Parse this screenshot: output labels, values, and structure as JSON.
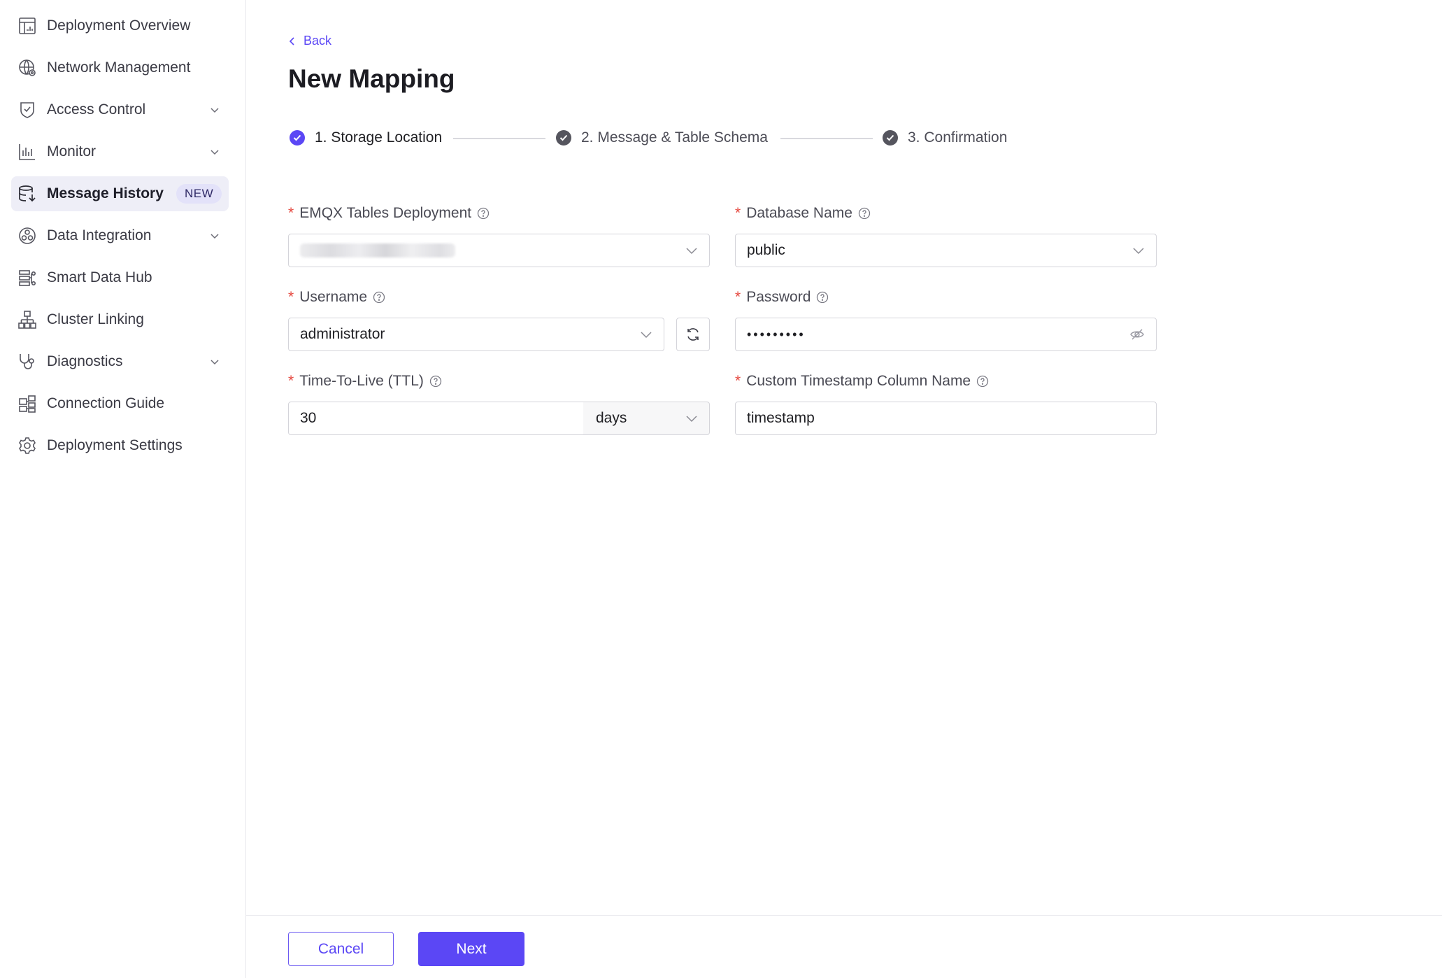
{
  "sidebar": {
    "items": [
      {
        "label": "Deployment Overview",
        "icon": "dashboard-icon",
        "expandable": false
      },
      {
        "label": "Network Management",
        "icon": "globe-gear-icon",
        "expandable": false
      },
      {
        "label": "Access Control",
        "icon": "shield-check-icon",
        "expandable": true
      },
      {
        "label": "Monitor",
        "icon": "bar-chart-icon",
        "expandable": true
      },
      {
        "label": "Message History",
        "icon": "database-download-icon",
        "expandable": false,
        "active": true,
        "badge": "NEW"
      },
      {
        "label": "Data Integration",
        "icon": "integration-icon",
        "expandable": true
      },
      {
        "label": "Smart Data Hub",
        "icon": "data-hub-icon",
        "expandable": false
      },
      {
        "label": "Cluster Linking",
        "icon": "cluster-tree-icon",
        "expandable": false
      },
      {
        "label": "Diagnostics",
        "icon": "stethoscope-icon",
        "expandable": true
      },
      {
        "label": "Connection Guide",
        "icon": "connection-guide-icon",
        "expandable": false
      },
      {
        "label": "Deployment Settings",
        "icon": "gear-icon",
        "expandable": false
      }
    ]
  },
  "main": {
    "back_label": "Back",
    "title": "New Mapping",
    "steps": [
      {
        "label": "1. Storage Location",
        "status": "current"
      },
      {
        "label": "2. Message & Table Schema",
        "status": "pending"
      },
      {
        "label": "3. Confirmation",
        "status": "pending"
      }
    ],
    "form": {
      "deployment": {
        "label": "EMQX Tables Deployment",
        "required": "*",
        "value_obscured": true
      },
      "database": {
        "label": "Database Name",
        "required": "*",
        "value": "public"
      },
      "username": {
        "label": "Username",
        "required": "*",
        "value": "administrator"
      },
      "password": {
        "label": "Password",
        "required": "*",
        "masked_value": "•••••••••"
      },
      "ttl": {
        "label": "Time-To-Live (TTL)",
        "required": "*",
        "value": "30",
        "unit": "days"
      },
      "timestamp_column": {
        "label": "Custom Timestamp Column Name",
        "required": "*",
        "value": "timestamp"
      }
    }
  },
  "footer": {
    "cancel_label": "Cancel",
    "next_label": "Next"
  },
  "colors": {
    "accent": "#5b47f5",
    "required": "#e5483f",
    "active_nav_bg": "#eeeef7",
    "step_done": "#55555e"
  }
}
